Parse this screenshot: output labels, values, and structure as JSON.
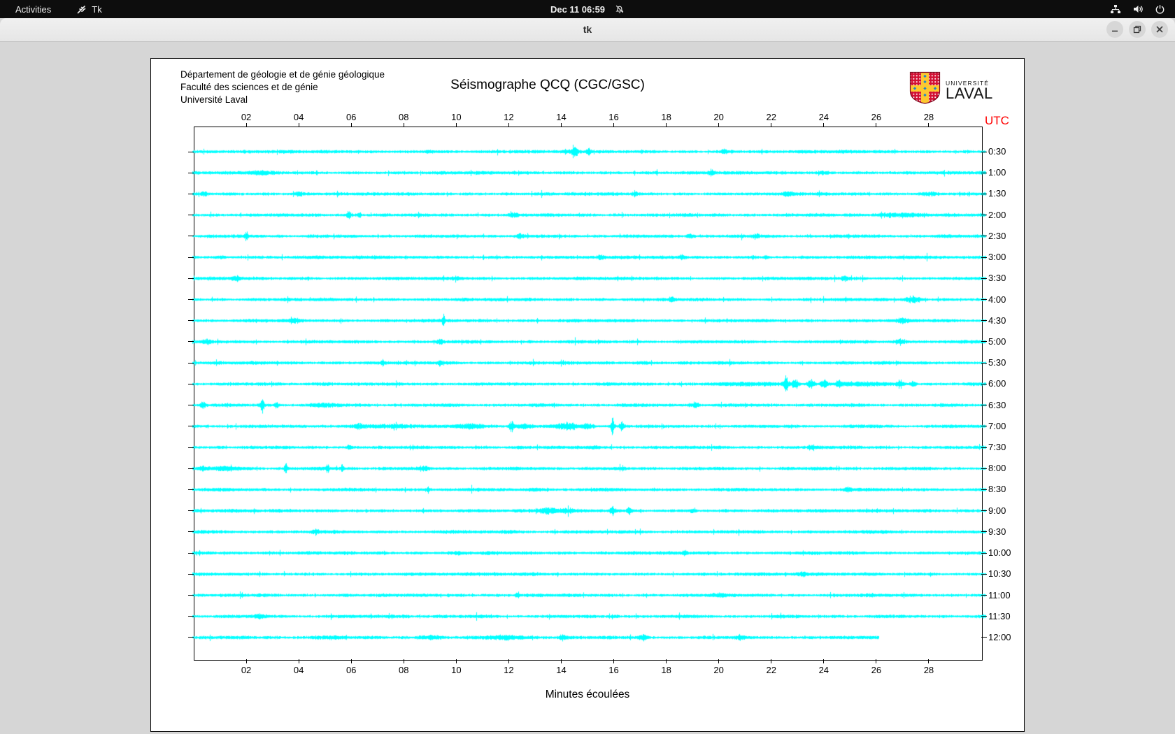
{
  "top_bar": {
    "activities_label": "Activities",
    "app_name": "Tk",
    "clock": "Dec 11 06:59",
    "icons": [
      "tk-icon",
      "notifications-disabled-icon",
      "network-icon",
      "volume-icon",
      "power-icon"
    ]
  },
  "window": {
    "title": "tk",
    "controls": [
      "minimize",
      "maximize",
      "close"
    ]
  },
  "header": {
    "lines": [
      "Département de géologie et de génie géologique",
      "Faculté des sciences et de génie",
      "Université Laval"
    ],
    "title": "Séismographe QCQ (CGC/GSC)",
    "logo": {
      "small": "UNIVERSITÉ",
      "large": "LAVAL"
    }
  },
  "plot": {
    "utc_label": "UTC",
    "utc_color": "#ff0000",
    "xlabel": "Minutes écoulées",
    "trace_color": "#00ffff",
    "x_range_minutes": [
      0,
      30
    ],
    "x_ticks": [
      "02",
      "04",
      "06",
      "08",
      "10",
      "12",
      "14",
      "16",
      "18",
      "20",
      "22",
      "24",
      "26",
      "28"
    ],
    "x_tick_minutes": [
      2,
      4,
      6,
      8,
      10,
      12,
      14,
      16,
      18,
      20,
      22,
      24,
      26,
      28
    ],
    "row_labels": [
      "0:30",
      "1:00",
      "1:30",
      "2:00",
      "2:30",
      "3:00",
      "3:30",
      "4:00",
      "4:30",
      "5:00",
      "5:30",
      "6:00",
      "6:30",
      "7:00",
      "7:30",
      "8:00",
      "8:30",
      "9:00",
      "9:30",
      "10:00",
      "10:30",
      "11:00",
      "11:30",
      "12:00"
    ],
    "rows": [
      {
        "label": "0:30",
        "events": [
          [
            14.5,
            0.12,
            7
          ],
          [
            15.05,
            0.08,
            4
          ],
          [
            20.2,
            0.1,
            3.5
          ],
          [
            9.0,
            0.3,
            1.2
          ]
        ]
      },
      {
        "label": "1:00",
        "events": [
          [
            2.5,
            0.4,
            1.5
          ],
          [
            19.7,
            0.12,
            3.5
          ],
          [
            24.0,
            0.2,
            1.5
          ]
        ]
      },
      {
        "label": "1:30",
        "events": [
          [
            0.4,
            0.1,
            3
          ],
          [
            4.0,
            0.1,
            3.5
          ],
          [
            16.8,
            0.1,
            3.5
          ],
          [
            22.6,
            0.15,
            2.5
          ],
          [
            28.0,
            0.3,
            2
          ]
        ]
      },
      {
        "label": "2:00",
        "events": [
          [
            5.9,
            0.08,
            4.5
          ],
          [
            6.3,
            0.08,
            3.5
          ],
          [
            12.2,
            0.15,
            2.5
          ],
          [
            26.8,
            0.8,
            2.2
          ]
        ]
      },
      {
        "label": "2:30",
        "events": [
          [
            2.0,
            0.05,
            7
          ],
          [
            12.4,
            0.12,
            3
          ],
          [
            18.9,
            0.12,
            3
          ],
          [
            21.4,
            0.15,
            2.5
          ]
        ]
      },
      {
        "label": "3:00",
        "events": [
          [
            1.0,
            0.2,
            1.5
          ],
          [
            15.5,
            0.12,
            3
          ],
          [
            18.6,
            0.1,
            2.5
          ],
          [
            21.8,
            0.12,
            2.5
          ]
        ]
      },
      {
        "label": "3:30",
        "events": [
          [
            1.6,
            0.15,
            2.8
          ],
          [
            10.0,
            0.2,
            1.5
          ],
          [
            24.8,
            0.12,
            3
          ]
        ]
      },
      {
        "label": "4:00",
        "events": [
          [
            18.2,
            0.1,
            2.2
          ],
          [
            27.4,
            0.25,
            3.5
          ]
        ]
      },
      {
        "label": "4:30",
        "events": [
          [
            3.8,
            0.15,
            2
          ],
          [
            9.5,
            0.06,
            7.5
          ],
          [
            27.0,
            0.2,
            2.5
          ]
        ]
      },
      {
        "label": "5:00",
        "events": [
          [
            0.5,
            0.15,
            2.5
          ],
          [
            9.4,
            0.1,
            2.8
          ],
          [
            26.9,
            0.2,
            3.5
          ]
        ]
      },
      {
        "label": "5:30",
        "events": [
          [
            7.2,
            0.08,
            3
          ],
          [
            9.35,
            0.1,
            3
          ],
          [
            17.0,
            0.3,
            1.2
          ]
        ]
      },
      {
        "label": "6:00",
        "events": [
          [
            5.0,
            0.3,
            1.5
          ],
          [
            21.0,
            1.5,
            1.2
          ],
          [
            22.55,
            0.1,
            12
          ],
          [
            22.9,
            0.12,
            6
          ],
          [
            23.5,
            0.12,
            5
          ],
          [
            24.0,
            0.12,
            5.5
          ],
          [
            24.55,
            0.1,
            4.5
          ],
          [
            25.5,
            1.0,
            1.5
          ],
          [
            26.9,
            0.12,
            5
          ],
          [
            27.4,
            0.1,
            3.5
          ]
        ]
      },
      {
        "label": "6:30",
        "events": [
          [
            0.35,
            0.1,
            4.5
          ],
          [
            2.6,
            0.07,
            9
          ],
          [
            3.15,
            0.08,
            4
          ],
          [
            5.0,
            0.5,
            1.5
          ],
          [
            19.1,
            0.15,
            4
          ]
        ]
      },
      {
        "label": "7:00",
        "events": [
          [
            6.3,
            0.2,
            2.5
          ],
          [
            8.0,
            1.5,
            1.5
          ],
          [
            10.5,
            0.5,
            2
          ],
          [
            12.1,
            0.1,
            6
          ],
          [
            12.6,
            0.3,
            3
          ],
          [
            14.2,
            0.4,
            4
          ],
          [
            15.0,
            0.2,
            3.5
          ],
          [
            15.95,
            0.07,
            10
          ],
          [
            16.3,
            0.08,
            6
          ]
        ]
      },
      {
        "label": "7:30",
        "events": [
          [
            5.9,
            0.1,
            2.6
          ],
          [
            15.3,
            0.2,
            1.5
          ],
          [
            23.5,
            0.12,
            2.2
          ]
        ]
      },
      {
        "label": "8:00",
        "events": [
          [
            0.3,
            0.15,
            2.5
          ],
          [
            1.3,
            0.5,
            2
          ],
          [
            3.5,
            0.06,
            6
          ],
          [
            5.1,
            0.06,
            5
          ],
          [
            5.65,
            0.06,
            5
          ],
          [
            8.8,
            0.15,
            2
          ]
        ]
      },
      {
        "label": "8:30",
        "events": [
          [
            8.9,
            0.12,
            2.5
          ],
          [
            13.0,
            0.3,
            1.2
          ],
          [
            24.9,
            0.12,
            2.8
          ]
        ]
      },
      {
        "label": "9:00",
        "events": [
          [
            13.5,
            0.3,
            4
          ],
          [
            14.2,
            0.2,
            3
          ],
          [
            15.95,
            0.1,
            4.5
          ],
          [
            16.6,
            0.1,
            4
          ],
          [
            19.0,
            0.12,
            2.5
          ]
        ]
      },
      {
        "label": "9:30",
        "events": [
          [
            4.65,
            0.1,
            3
          ],
          [
            12.0,
            0.3,
            1.2
          ]
        ]
      },
      {
        "label": "10:00",
        "events": [
          [
            10.0,
            0.3,
            1
          ],
          [
            18.7,
            0.1,
            2.5
          ]
        ]
      },
      {
        "label": "10:30",
        "events": [
          [
            23.2,
            0.15,
            1.8
          ]
        ]
      },
      {
        "label": "11:00",
        "events": [
          [
            12.3,
            0.1,
            2.2
          ],
          [
            20.0,
            0.3,
            1
          ]
        ]
      },
      {
        "label": "11:30",
        "events": [
          [
            2.5,
            0.2,
            2.5
          ],
          [
            8.0,
            0.3,
            1.5
          ],
          [
            16.0,
            0.2,
            1.5
          ]
        ]
      },
      {
        "label": "12:00",
        "end_minute": 26.1,
        "events": [
          [
            5.0,
            0.5,
            1.5
          ],
          [
            8.9,
            0.4,
            2.5
          ],
          [
            12.0,
            0.8,
            2
          ],
          [
            14.05,
            0.15,
            3.5
          ],
          [
            17.1,
            0.15,
            3.5
          ],
          [
            20.8,
            0.15,
            2.5
          ]
        ]
      }
    ]
  }
}
